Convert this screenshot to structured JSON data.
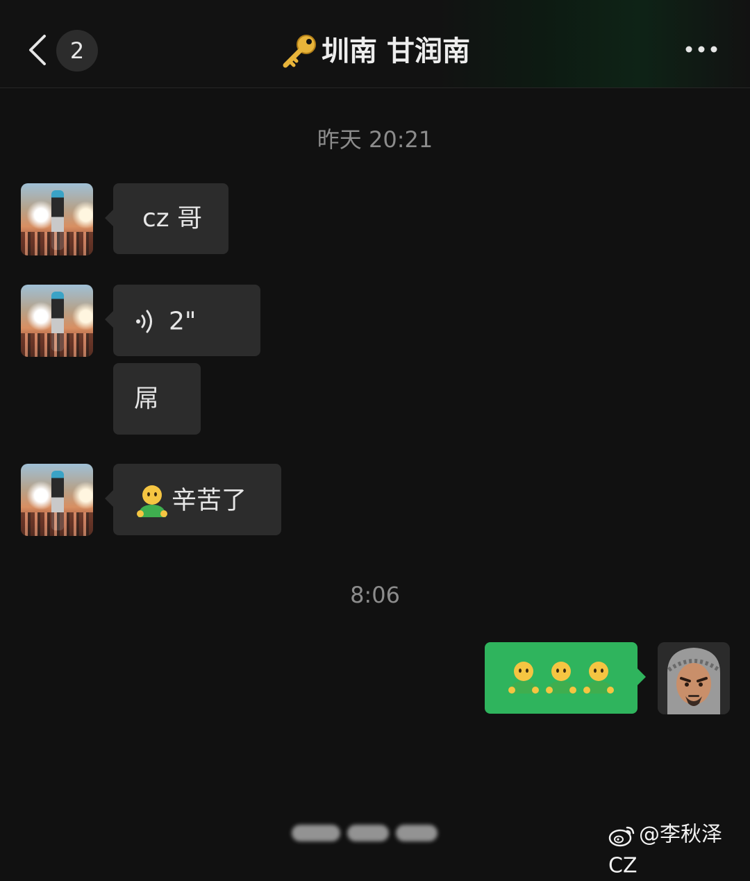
{
  "header": {
    "back_icon": "chevron-left-icon",
    "unread_count": "2",
    "title_icon": "key-icon",
    "title": "圳南 甘润南",
    "more_icon": "ellipsis-icon"
  },
  "messages": {
    "timestamp_1": "昨天 20:21",
    "msg_1": "cz 哥",
    "msg_2_duration": "2\"",
    "msg_2_icon": "voice-icon",
    "msg_3": "屌",
    "msg_4_emoji": "person-emoji",
    "msg_4": "辛苦了",
    "timestamp_2": "8:06",
    "msg_5_emoji_count": 3
  },
  "watermark": {
    "icon": "weibo-icon",
    "text": "@李秋泽CZ"
  },
  "colors": {
    "background": "#111111",
    "incoming_bubble": "#2c2c2c",
    "outgoing_bubble": "#2fb45d",
    "timestamp": "#8c8c8c"
  }
}
